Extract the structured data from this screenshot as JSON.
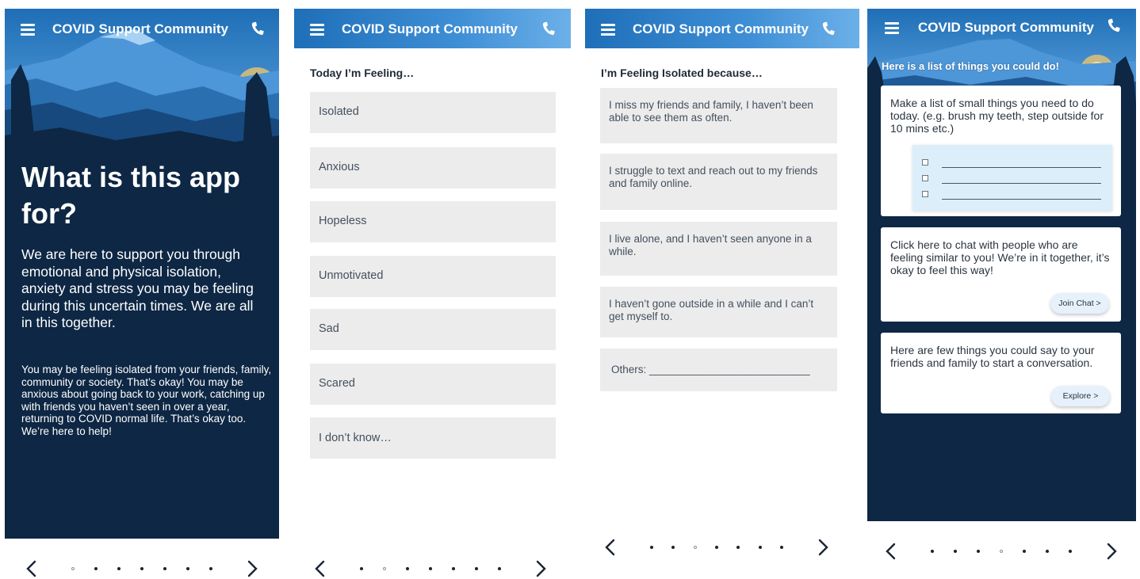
{
  "app": {
    "title": "COVID Support Community"
  },
  "screen1": {
    "title": "What is this app for?",
    "intro": "We are here to support you through emotional and physical isolation, anxiety and stress you may be feeling during this uncertain times. We are all in this together.",
    "body": "You may be feeling isolated from your friends, family, community or society. That’s okay! You may be anxious about going back to your work, catching up with friends you haven’t seen in over a year, returning to COVID normal life. That’s okay too. We’re here to help!"
  },
  "screen2": {
    "heading": "Today I’m Feeling…",
    "options": [
      "Isolated",
      "Anxious",
      "Hopeless",
      "Unmotivated",
      "Sad",
      "Scared",
      "I don’t know…"
    ]
  },
  "screen3": {
    "heading": "I’m Feeling Isolated because…",
    "reasons": [
      "I miss my friends and family, I haven’t been able to see them as often.",
      "I struggle to text and reach out to my friends and family online.",
      "I live alone, and I haven’t seen anyone in a while.",
      "I haven’t gone outside in a while and I can’t get myself to."
    ],
    "others_label": "Others: ___________________________"
  },
  "screen4": {
    "heading": "Here is a list of things you could do!",
    "card1_text": "Make a list of small things you need to do today.  (e.g. brush my teeth, step outside for 10 mins etc.)",
    "card2_text": "Click here to chat with people who are feeling similar to you! We’re in it together, it’s okay to feel this way!",
    "card2_button": "Join Chat >",
    "card3_text": "Here are few things you could say to your friends and family to start a conversation.",
    "card3_button": "Explore >"
  },
  "pagers": [
    {
      "active_index": 0,
      "dot_count": 7
    },
    {
      "active_index": 1,
      "dot_count": 7
    },
    {
      "active_index": 2,
      "dot_count": 7
    },
    {
      "active_index": 3,
      "dot_count": 7
    }
  ],
  "colors": {
    "navy": "#0d2744",
    "header_blue": "#1e6fb8",
    "option_gray": "#ececec",
    "pill_blue": "#e6f1fb"
  },
  "icons": [
    "menu-icon",
    "phone-icon",
    "chevron-left-icon",
    "chevron-right-icon",
    "checkbox-icon"
  ]
}
